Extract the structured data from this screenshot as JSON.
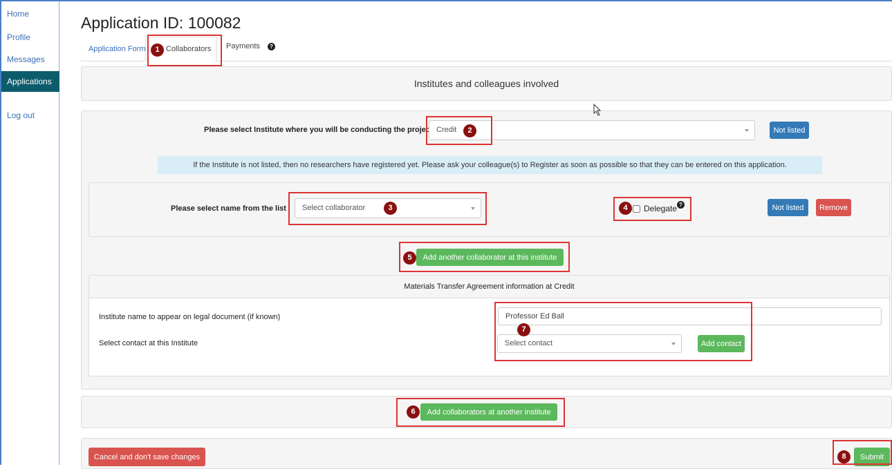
{
  "sidebar": {
    "items": [
      {
        "label": "Home"
      },
      {
        "label": "Profile"
      },
      {
        "label": "Messages"
      },
      {
        "label": "Applications"
      },
      {
        "label": "Log out"
      }
    ]
  },
  "page": {
    "title": "Application ID: 100082"
  },
  "tabs": [
    {
      "label": "Application Form"
    },
    {
      "label": "Collaborators"
    },
    {
      "label": "Payments"
    }
  ],
  "section_header": "Institutes and colleagues involved",
  "institute": {
    "label": "Please select Institute where you will be conducting the project",
    "selected": "Credit",
    "not_listed_label": "Not listed",
    "info_text": "If the Institute is not listed, then no researchers have registered yet. Please ask your colleague(s) to Register as soon as possible so that they can be entered on this application."
  },
  "collaborator": {
    "label": "Please select name from the list",
    "placeholder": "Select collaborator",
    "delegate_label": "Delegate",
    "not_listed_label": "Not listed",
    "remove_label": "Remove",
    "add_another_label": "Add another collaborator at this institute"
  },
  "mta": {
    "header": "Materials Transfer Agreement information at Credit",
    "institute_name_label": "Institute name to appear on legal document (if known)",
    "institute_name_value": "Professor Ed Ball",
    "contact_label": "Select contact at this Institute",
    "contact_placeholder": "Select contact",
    "add_contact_label": "Add contact"
  },
  "add_another_institute_label": "Add collaborators at another institute",
  "footer": {
    "cancel_label": "Cancel and don't save changes",
    "submit_label": "Submit"
  },
  "annotations": [
    "1",
    "2",
    "3",
    "4",
    "5",
    "6",
    "7",
    "8"
  ],
  "colors": {
    "annotation_border": "#dd3333",
    "annotation_badge": "#8a1010",
    "primary": "#337ab7",
    "danger": "#d9534f",
    "success": "#5cb85c",
    "sidebar_active": "#0d5c6b",
    "info_bg": "#d9edf7"
  }
}
